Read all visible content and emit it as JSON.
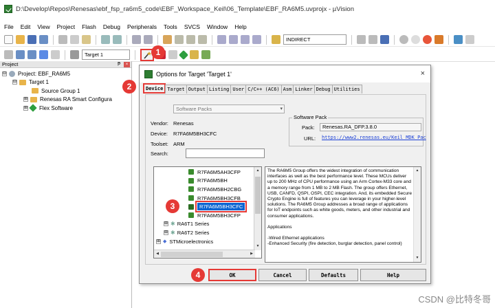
{
  "window": {
    "title": "D:\\Develop\\Repos\\Renesas\\ebf_fsp_ra6m5_code\\EBF_Workspace_Keil\\06_Template\\EBF_RA6M5.uvprojx - µVision"
  },
  "menu": [
    "File",
    "Edit",
    "View",
    "Project",
    "Flash",
    "Debug",
    "Peripherals",
    "Tools",
    "SVCS",
    "Window",
    "Help"
  ],
  "toolbar": {
    "indirect": "INDIRECT",
    "target": "Target 1"
  },
  "project_panel": {
    "header": "Project",
    "pin": "ᵽ",
    "close": "×",
    "rows": [
      {
        "label": "Project: EBF_RA6M5",
        "toggle": "⊟"
      },
      {
        "label": "Target 1",
        "toggle": "⊟"
      },
      {
        "label": "Source Group 1"
      },
      {
        "label": "Renesas RA Smart Configura",
        "toggle": "⊞"
      },
      {
        "label": "Flex Software",
        "toggle": "⊞"
      }
    ]
  },
  "dialog": {
    "title": "Options for Target 'Target 1'",
    "close": "×",
    "tabs": [
      "Device",
      "Target",
      "Output",
      "Listing",
      "User",
      "C/C++ (AC6)",
      "Asm",
      "Linker",
      "Debug",
      "Utilities"
    ],
    "software_packs": "Software Packs",
    "vendor_label": "Vendor:",
    "vendor": "Renesas",
    "device_label": "Device:",
    "device": "R7FA6M5BH3CFC",
    "toolset_label": "Toolset:",
    "toolset": "ARM",
    "search_label": "Search:",
    "pack_group": "Software Pack",
    "pack_label": "Pack:",
    "pack": "Renesas.RA_DFP.3.8.0",
    "url_label": "URL:",
    "url": "https://www2.renesas.eu/Keil_MDK_Pac",
    "devices": [
      {
        "label": "R7FA6M5AH3CFP"
      },
      {
        "label": "R7FA6M5BH"
      },
      {
        "label": "R7FA6M5BH2CBG"
      },
      {
        "label": "R7FA6M5BH3CFB"
      },
      {
        "label": "R7FA6M5BH3CFC"
      },
      {
        "label": "R7FA6M5BH3CFP"
      },
      {
        "label": "RA6T1 Series",
        "toggle": "⊞"
      },
      {
        "label": "RA6T2 Series",
        "toggle": "⊞"
      },
      {
        "label": "STMicroelectronics",
        "toggle": "⊞"
      }
    ],
    "description": [
      "The RA6M5 Group offers the widest integration of communication interfaces as well as the best performance level. These MCUs deliver up to 200 MHz of CPU performance using an Arm Cortex-M33 core and a memory range from 1 MB to 2 MB Flash. The group offers Ethernet, USB, CANFD, QSPI, OSPI, CEC integration. And, its embedded Secure Crypto Engine is full of features you can leverage in your higher-level solutions. The RA6M5 Group addresses a broad range of applications for IoT endpoints such as white goods, meters, and other industrial and consumer applications.",
      "Applications",
      "-Wired Ethernet applications\n-Enhanced Security (fire detection, burglar detection, panel control)"
    ],
    "buttons": {
      "ok": "OK",
      "cancel": "Cancel",
      "defaults": "Defaults",
      "help": "Help"
    }
  },
  "badges": [
    "1",
    "2",
    "3",
    "4"
  ],
  "watermark": "CSDN @比特冬哥"
}
